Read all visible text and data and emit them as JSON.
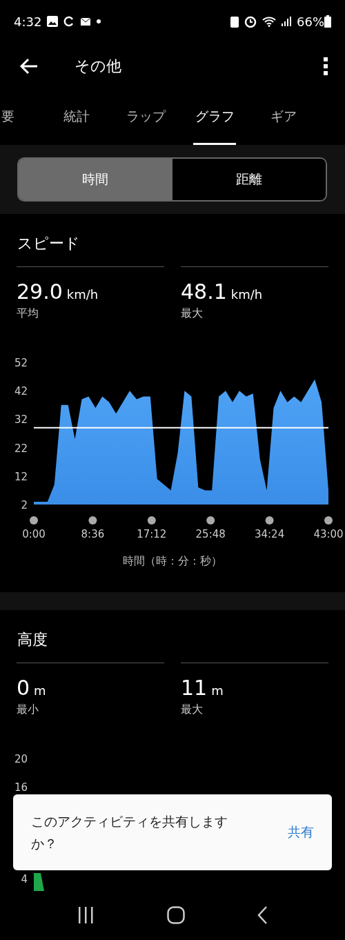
{
  "status_bar": {
    "time": "4:32",
    "battery": "66%"
  },
  "header": {
    "title": "その他"
  },
  "tabs": [
    {
      "label": "要",
      "selected": false
    },
    {
      "label": "統計",
      "selected": false
    },
    {
      "label": "ラップ",
      "selected": false
    },
    {
      "label": "グラフ",
      "selected": true
    },
    {
      "label": "ギア",
      "selected": false
    }
  ],
  "segments": [
    {
      "label": "時間",
      "selected": true
    },
    {
      "label": "距離",
      "selected": false
    }
  ],
  "speed": {
    "title": "スピード",
    "stats": [
      {
        "value": "29.0",
        "unit": "km/h",
        "label": "平均"
      },
      {
        "value": "48.1",
        "unit": "km/h",
        "label": "最大"
      }
    ],
    "chart_data": {
      "type": "area",
      "xlabel": "時間（時：分：秒）",
      "x": [
        0,
        1,
        2,
        3,
        4,
        5,
        6,
        7,
        8,
        9,
        10,
        11,
        12,
        13,
        14,
        15,
        16,
        17,
        18,
        19,
        20,
        21,
        22,
        23,
        24,
        25,
        26,
        27,
        28,
        29,
        30,
        31,
        32,
        33,
        34,
        35,
        36,
        37,
        38,
        39,
        40,
        41,
        42,
        43
      ],
      "series": [
        {
          "color": "#3a8ee8",
          "values": [
            3,
            3,
            3,
            9,
            37,
            37,
            25,
            39,
            40,
            36,
            40,
            38,
            34,
            38,
            42,
            39,
            40,
            40,
            11,
            9,
            7,
            20,
            42,
            40,
            8,
            7,
            7,
            40,
            42,
            38,
            42,
            40,
            41,
            18,
            7,
            36,
            42,
            38,
            40,
            38,
            42,
            46,
            38,
            7
          ]
        }
      ],
      "xlim": [
        0,
        43
      ],
      "ylim": [
        2,
        52
      ],
      "yticks": [
        2,
        12,
        22,
        32,
        42,
        52
      ],
      "xticks": [
        {
          "value": 0,
          "label": "0:00"
        },
        {
          "value": 8.6,
          "label": "8:36"
        },
        {
          "value": 17.2,
          "label": "17:12"
        },
        {
          "value": 25.8,
          "label": "25:48"
        },
        {
          "value": 34.4,
          "label": "34:24"
        },
        {
          "value": 43,
          "label": "43:00"
        }
      ],
      "ref_lines": [
        {
          "axis": "y",
          "value": 29.0
        }
      ]
    }
  },
  "altitude": {
    "title": "高度",
    "stats": [
      {
        "value": "0",
        "unit": "m",
        "label": "最小"
      },
      {
        "value": "11",
        "unit": "m",
        "label": "最大"
      }
    ],
    "y_axis_labels": [
      "20",
      "16",
      "4"
    ]
  },
  "snackbar": {
    "message": "このアクティビティを共有しますか？",
    "action": "共有"
  }
}
